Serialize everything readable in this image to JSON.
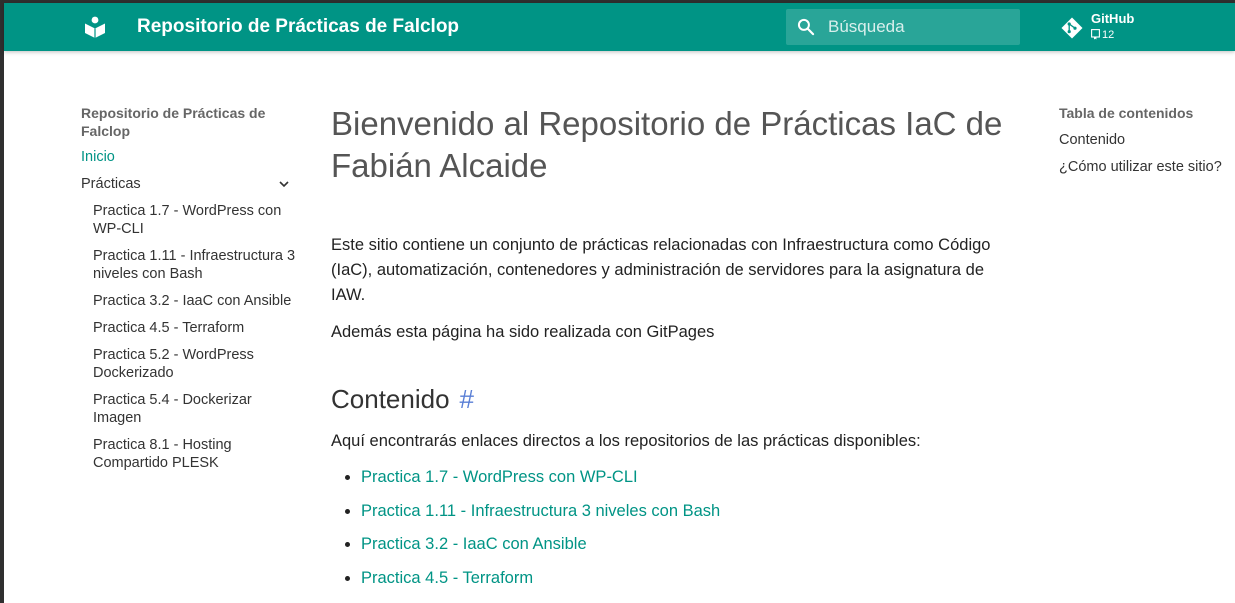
{
  "header": {
    "site_title": "Repositorio de Prácticas de Falclop",
    "search_placeholder": "Búsqueda",
    "repo_name": "GitHub",
    "repo_count": "12"
  },
  "sidebar": {
    "title": "Repositorio de Prácticas de Falclop",
    "home": "Inicio",
    "section": "Prácticas",
    "items": [
      "Practica 1.7 - WordPress con WP-CLI",
      "Practica 1.11 - Infraestructura 3 niveles con Bash",
      "Practica 3.2 - IaaC con Ansible",
      "Practica 4.5 - Terraform",
      "Practica 5.2 - WordPress Dockerizado",
      "Practica 5.4 - Dockerizar Imagen",
      "Practica 8.1 - Hosting Compartido PLESK"
    ]
  },
  "content": {
    "title": "Bienvenido al Repositorio de Prácticas IaC de Fabián Alcaide",
    "intro": "Este sitio contiene un conjunto de prácticas relacionadas con Infraestructura como Código (IaC), automatización, contenedores y administración de servidores para la asignatura de IAW.",
    "note": "Además esta página ha sido realizada con GitPages",
    "section_heading": "Contenido",
    "anchor": "#",
    "section_intro": "Aquí encontrarás enlaces directos a los repositorios de las prácticas disponibles:",
    "links": [
      "Practica 1.7 - WordPress con WP-CLI",
      "Practica 1.11 - Infraestructura 3 niveles con Bash",
      "Practica 3.2 - IaaC con Ansible",
      "Practica 4.5 - Terraform"
    ]
  },
  "toc": {
    "title": "Tabla de contenidos",
    "items": [
      "Contenido",
      "¿Cómo utilizar este sitio?"
    ]
  },
  "colors": {
    "header_bg": "#009485",
    "link": "#009485"
  },
  "icons": [
    "logo-icon",
    "search-icon",
    "git-icon",
    "repo-icon",
    "chevron-down-icon"
  ]
}
